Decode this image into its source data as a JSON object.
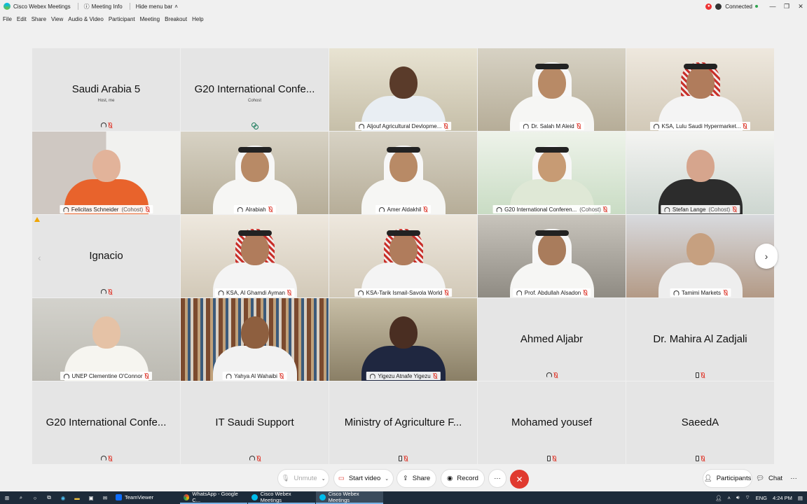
{
  "titlebar": {
    "app_name": "Cisco Webex Meetings",
    "meeting_info": "Meeting Info",
    "hide_menu": "Hide menu bar",
    "status": "Connected"
  },
  "menu": [
    "File",
    "Edit",
    "Share",
    "View",
    "Audio & Video",
    "Participant",
    "Meeting",
    "Breakout",
    "Help"
  ],
  "tiles": [
    {
      "name": "Saudi Arabia 5",
      "sub": "Host, me",
      "type": "text",
      "status": "head"
    },
    {
      "name": "G20 International Confe...",
      "sub": "Cohost",
      "type": "text",
      "status": "cohost"
    },
    {
      "name": "Aljouf Agricultural Devlopme...",
      "type": "video",
      "scene": "group"
    },
    {
      "name": "Dr. Salah M Aleid",
      "type": "video",
      "scene": "white"
    },
    {
      "name": "KSA, Lulu Saudi Hypermarket...",
      "type": "video",
      "scene": "red"
    },
    {
      "name": "Felicitas Schneider",
      "cohost": "(Cohost)",
      "type": "video",
      "scene": "thunen"
    },
    {
      "name": "Alrabiah",
      "type": "video",
      "scene": "white"
    },
    {
      "name": "Amer Aldakhil",
      "type": "video",
      "scene": "white"
    },
    {
      "name": "G20 International Conferen...",
      "cohost": "(Cohost)",
      "type": "video",
      "scene": "g20"
    },
    {
      "name": "Stefan Lange",
      "cohost": "(Cohost)",
      "type": "video",
      "scene": "thunen2"
    },
    {
      "name": "Ignacio",
      "type": "text",
      "status": "head"
    },
    {
      "name": "KSA, Al Ghamdi Ayman",
      "type": "video",
      "scene": "red"
    },
    {
      "name": "KSA-Tarik Ismail-Savola World",
      "type": "video",
      "scene": "red"
    },
    {
      "name": "Prof. Abdullah Alsadon",
      "type": "video",
      "scene": "office"
    },
    {
      "name": "Tamimi Markets",
      "type": "video",
      "scene": "room"
    },
    {
      "name": "UNEP Clementine O'Connor",
      "type": "video",
      "scene": "woman"
    },
    {
      "name": "Yahya Al Wahaibi",
      "type": "video",
      "scene": "books"
    },
    {
      "name": "Yigezu Atnafe Yigezu",
      "type": "video",
      "scene": "suit"
    },
    {
      "name": "Ahmed Aljabr",
      "type": "text",
      "status": "head"
    },
    {
      "name": "Dr. Mahira Al Zadjali",
      "type": "text",
      "status": "phone"
    },
    {
      "name": "G20 International Confe...",
      "type": "text",
      "status": "head"
    },
    {
      "name": "IT Saudi Support",
      "type": "text",
      "status": "head"
    },
    {
      "name": "Ministry of Agriculture F...",
      "type": "text",
      "status": "phone"
    },
    {
      "name": "Mohamed yousef",
      "type": "text",
      "status": "phone"
    },
    {
      "name": "SaeedA",
      "type": "text",
      "status": "phone"
    }
  ],
  "controls": {
    "unmute": "Unmute",
    "start_video": "Start video",
    "share": "Share",
    "record": "Record",
    "more": "···",
    "end": "✕",
    "participants": "Participants",
    "chat": "Chat"
  },
  "taskbar": {
    "apps": [
      "TeamViewer",
      "WhatsApp - Google C...",
      "Cisco Webex Meetings",
      "Cisco Webex Meetings"
    ],
    "lang": "ENG",
    "time": "4:24 PM"
  }
}
